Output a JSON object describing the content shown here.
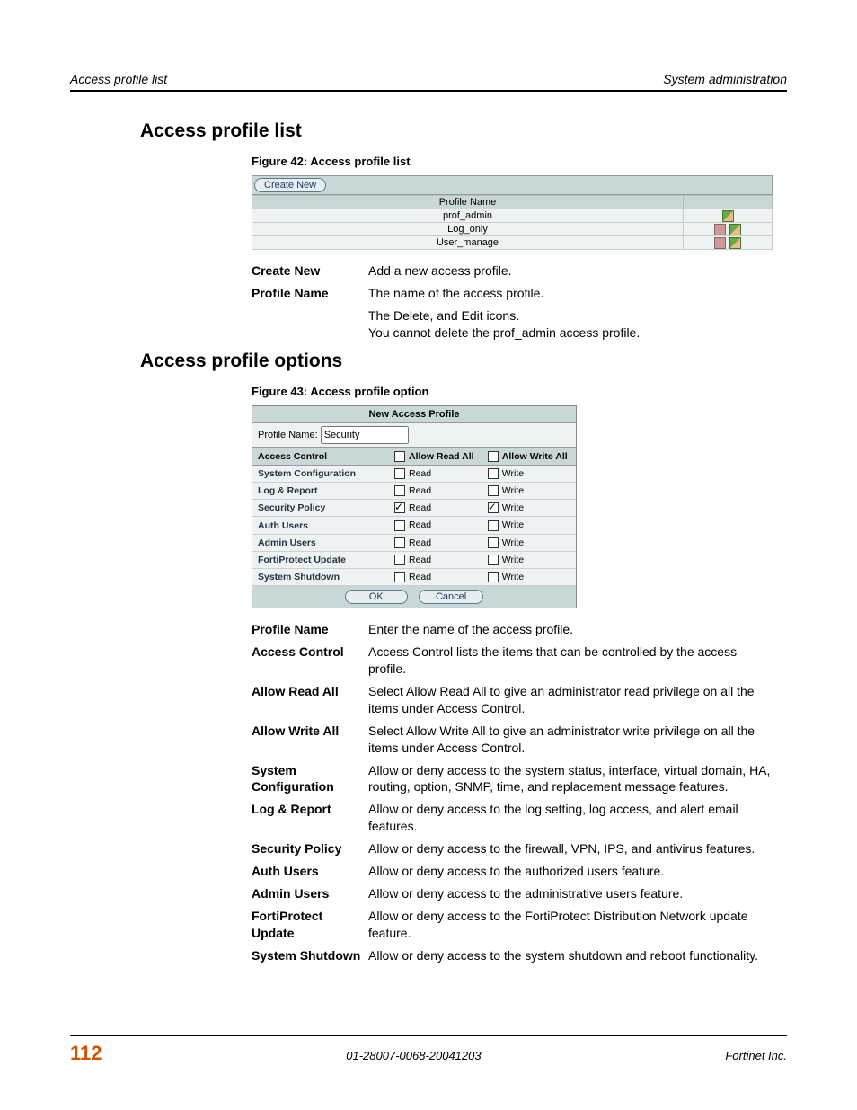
{
  "header": {
    "left": "Access profile list",
    "right": "System administration"
  },
  "section1": {
    "title": "Access profile list",
    "figcap": "Figure 42: Access profile list",
    "createBtn": "Create New",
    "table": {
      "col1": "Profile Name",
      "rows": [
        "prof_admin",
        "Log_only",
        "User_manage"
      ]
    },
    "defs": [
      {
        "term": "Create New",
        "desc": "Add a new access profile."
      },
      {
        "term": "Profile Name",
        "desc": "The name of the access profile."
      },
      {
        "term": "",
        "desc": "The Delete, and Edit icons.\nYou cannot delete the prof_admin access profile."
      }
    ]
  },
  "section2": {
    "title": "Access profile options",
    "figcap": "Figure 43: Access profile option",
    "formTitle": "New Access Profile",
    "profileLabel": "Profile Name:",
    "profileValue": "Security",
    "headers": {
      "c1": "Access Control",
      "c2": "Allow Read All",
      "c3": "Allow Write All"
    },
    "readLabel": "Read",
    "writeLabel": "Write",
    "rows": [
      {
        "name": "System Configuration",
        "read": false,
        "write": false
      },
      {
        "name": "Log & Report",
        "read": false,
        "write": false
      },
      {
        "name": "Security Policy",
        "read": true,
        "write": true
      },
      {
        "name": "Auth Users",
        "read": false,
        "write": false
      },
      {
        "name": "Admin Users",
        "read": false,
        "write": false
      },
      {
        "name": "FortiProtect Update",
        "read": false,
        "write": false
      },
      {
        "name": "System Shutdown",
        "read": false,
        "write": false
      }
    ],
    "okBtn": "OK",
    "cancelBtn": "Cancel",
    "defs": [
      {
        "term": "Profile Name",
        "desc": "Enter the name of the access profile."
      },
      {
        "term": "Access Control",
        "desc": "Access Control lists the items that can be controlled by the access profile."
      },
      {
        "term": "Allow Read All",
        "desc": "Select Allow Read All to give an administrator read privilege on all the items under Access Control."
      },
      {
        "term": "Allow Write All",
        "desc": "Select Allow Write All to give an administrator write privilege on all the items under Access Control."
      },
      {
        "term": "System Configuration",
        "desc": "Allow or deny access to the system status, interface, virtual domain, HA, routing, option, SNMP, time, and replacement message features."
      },
      {
        "term": "Log & Report",
        "desc": "Allow or deny access to the log setting, log access, and alert email features."
      },
      {
        "term": "Security Policy",
        "desc": "Allow or deny access to the firewall, VPN, IPS, and antivirus features."
      },
      {
        "term": "Auth Users",
        "desc": "Allow or deny access to the authorized users feature."
      },
      {
        "term": "Admin Users",
        "desc": "Allow or deny access to the administrative users feature."
      },
      {
        "term": "FortiProtect Update",
        "desc": "Allow or deny access to the FortiProtect Distribution Network update feature."
      },
      {
        "term": "System Shutdown",
        "desc": "Allow or deny access to the system shutdown and reboot functionality."
      }
    ]
  },
  "footer": {
    "page": "112",
    "mid": "01-28007-0068-20041203",
    "right": "Fortinet Inc."
  }
}
